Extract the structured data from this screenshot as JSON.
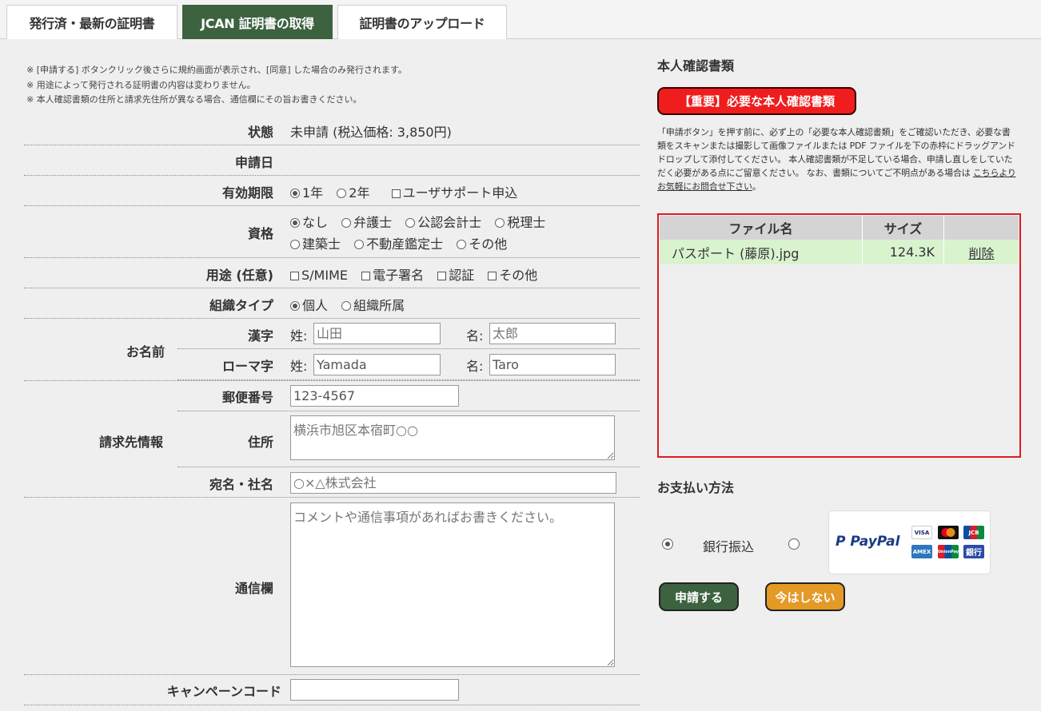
{
  "tabs": [
    {
      "label": "発行済・最新の証明書"
    },
    {
      "label": "JCAN 証明書の取得"
    },
    {
      "label": "証明書のアップロード"
    }
  ],
  "notes": [
    "※ [申請する] ボタンクリック後さらに規約画面が表示され、[同意] した場合のみ発行されます。",
    "※ 用途によって発行される証明書の内容は変わりません。",
    "※ 本人確認書類の住所と請求先住所が異なる場合、通信欄にその旨お書きください。"
  ],
  "form": {
    "status": {
      "label": "状態",
      "value": "未申請 (税込価格: 3,850円)"
    },
    "apply_date": {
      "label": "申請日",
      "value": ""
    },
    "validity": {
      "label": "有効期限",
      "options": [
        "1年",
        "2年",
        "ユーザサポート申込"
      ]
    },
    "qualification": {
      "label": "資格",
      "options": [
        "なし",
        "弁護士",
        "公認会計士",
        "税理士",
        "建築士",
        "不動産鑑定士",
        "その他"
      ]
    },
    "purpose": {
      "label": "用途 (任意)",
      "options": [
        "S/MIME",
        "電子署名",
        "認証",
        "その他"
      ]
    },
    "org_type": {
      "label": "組織タイプ",
      "options": [
        "個人",
        "組織所属"
      ]
    },
    "name": {
      "group_label": "お名前",
      "kanji": {
        "label": "漢字",
        "last_label": "姓:",
        "last_value": "山田",
        "first_label": "名:",
        "first_value": "太郎"
      },
      "romaji": {
        "label": "ローマ字",
        "last_label": "姓:",
        "last_value": "Yamada",
        "first_label": "名:",
        "first_value": "Taro"
      }
    },
    "billing": {
      "group_label": "請求先情報",
      "postal": {
        "label": "郵便番号",
        "value": "123-4567"
      },
      "address": {
        "label": "住所",
        "value": "横浜市旭区本宿町○○"
      }
    },
    "addressee": {
      "label": "宛名・社名",
      "value": "○×△株式会社"
    },
    "comments": {
      "label": "通信欄",
      "placeholder": "コメントや通信事項があればお書きください。"
    },
    "campaign": {
      "label": "キャンペーンコード",
      "value": ""
    }
  },
  "identity": {
    "heading": "本人確認書類",
    "important_button": "【重要】必要な本人確認書類",
    "description": "「申請ボタン」を押す前に、必ず上の「必要な本人確認書類」をご確認いただき、必要な書類をスキャンまたは撮影して画像ファイルまたは PDF ファイルを下の赤枠にドラッグアンドドロップして添付してください。 本人確認書類が不足している場合、申請し直しをしていただく必要がある点にご留意ください。 なお、書類についてご不明点がある場合は ",
    "contact_link": "こちらよりお気軽にお問合せ下さい",
    "description_end": "。",
    "files": {
      "col_name": "ファイル名",
      "col_size": "サイズ",
      "rows": [
        {
          "name": "パスポート (藤原).jpg",
          "size": "124.3K",
          "action": "削除"
        }
      ]
    }
  },
  "payment": {
    "heading": "お支払い方法",
    "bank_label": "銀行振込",
    "paypal_logo": "PayPal",
    "cards": [
      "VISA",
      "master",
      "JCB",
      "AMEX",
      "UnionPay",
      "銀行"
    ]
  },
  "buttons": {
    "apply": "申請する",
    "later": "今はしない"
  },
  "colors": {
    "accent_green": "#3c6240",
    "important_red": "#ef1d1d",
    "later_orange": "#e39a26",
    "file_row_green": "#d9f3cf"
  }
}
